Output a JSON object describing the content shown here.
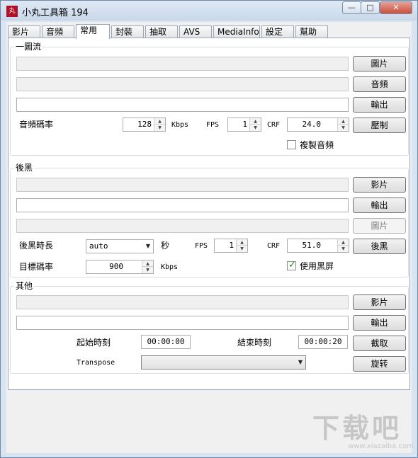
{
  "window": {
    "app_icon_text": "丸",
    "title": "小丸工具箱 194",
    "controls": {
      "minimize": "—",
      "maximize": "□",
      "close": "✕"
    }
  },
  "tabs": [
    "影片",
    "音頻",
    "常用",
    "封裝",
    "抽取",
    "AVS",
    "MediaInfo",
    "設定",
    "幫助"
  ],
  "active_tab": "常用",
  "audio_group": {
    "title": "一圖流",
    "image_path": "",
    "audio_path": "",
    "output_path": "",
    "image_button": "圖片",
    "audio_button": "音頻",
    "output_button": "輸出",
    "bitrate_label": "音頻碼率",
    "bitrate_value": "128",
    "kbps_label": "Kbps",
    "fps_label": "FPS",
    "fps_value": "1",
    "crf_label": "CRF",
    "crf_value": "24.0",
    "compress_button": "壓制",
    "copy_audio_label": "複製音頻",
    "copy_audio_checked": false
  },
  "black_group": {
    "title": "後黑",
    "video_path": "",
    "output_path": "",
    "image_path": "",
    "video_button": "影片",
    "output_button": "輸出",
    "image_button": "圖片",
    "duration_label": "後黑時長",
    "duration_value": "auto",
    "seconds_label": "秒",
    "fps_label": "FPS",
    "fps_value": "1",
    "crf_label": "CRF",
    "crf_value": "51.0",
    "black_button": "後黑",
    "target_bitrate_label": "目標碼率",
    "target_bitrate_value": "900",
    "kbps_label": "Kbps",
    "use_black_label": "使用黑屏",
    "use_black_checked": true
  },
  "other_group": {
    "title": "其他",
    "video_path": "",
    "output_path": "",
    "video_button": "影片",
    "output_button": "輸出",
    "start_label": "起始時刻",
    "start_value": "00:00:00",
    "end_label": "結束時刻",
    "end_value": "00:00:20",
    "cut_button": "截取",
    "transpose_label": "Transpose",
    "transpose_value": "",
    "rotate_button": "旋转"
  },
  "watermark": {
    "main": "下载吧",
    "sub": "www.xiazaiba.com"
  }
}
